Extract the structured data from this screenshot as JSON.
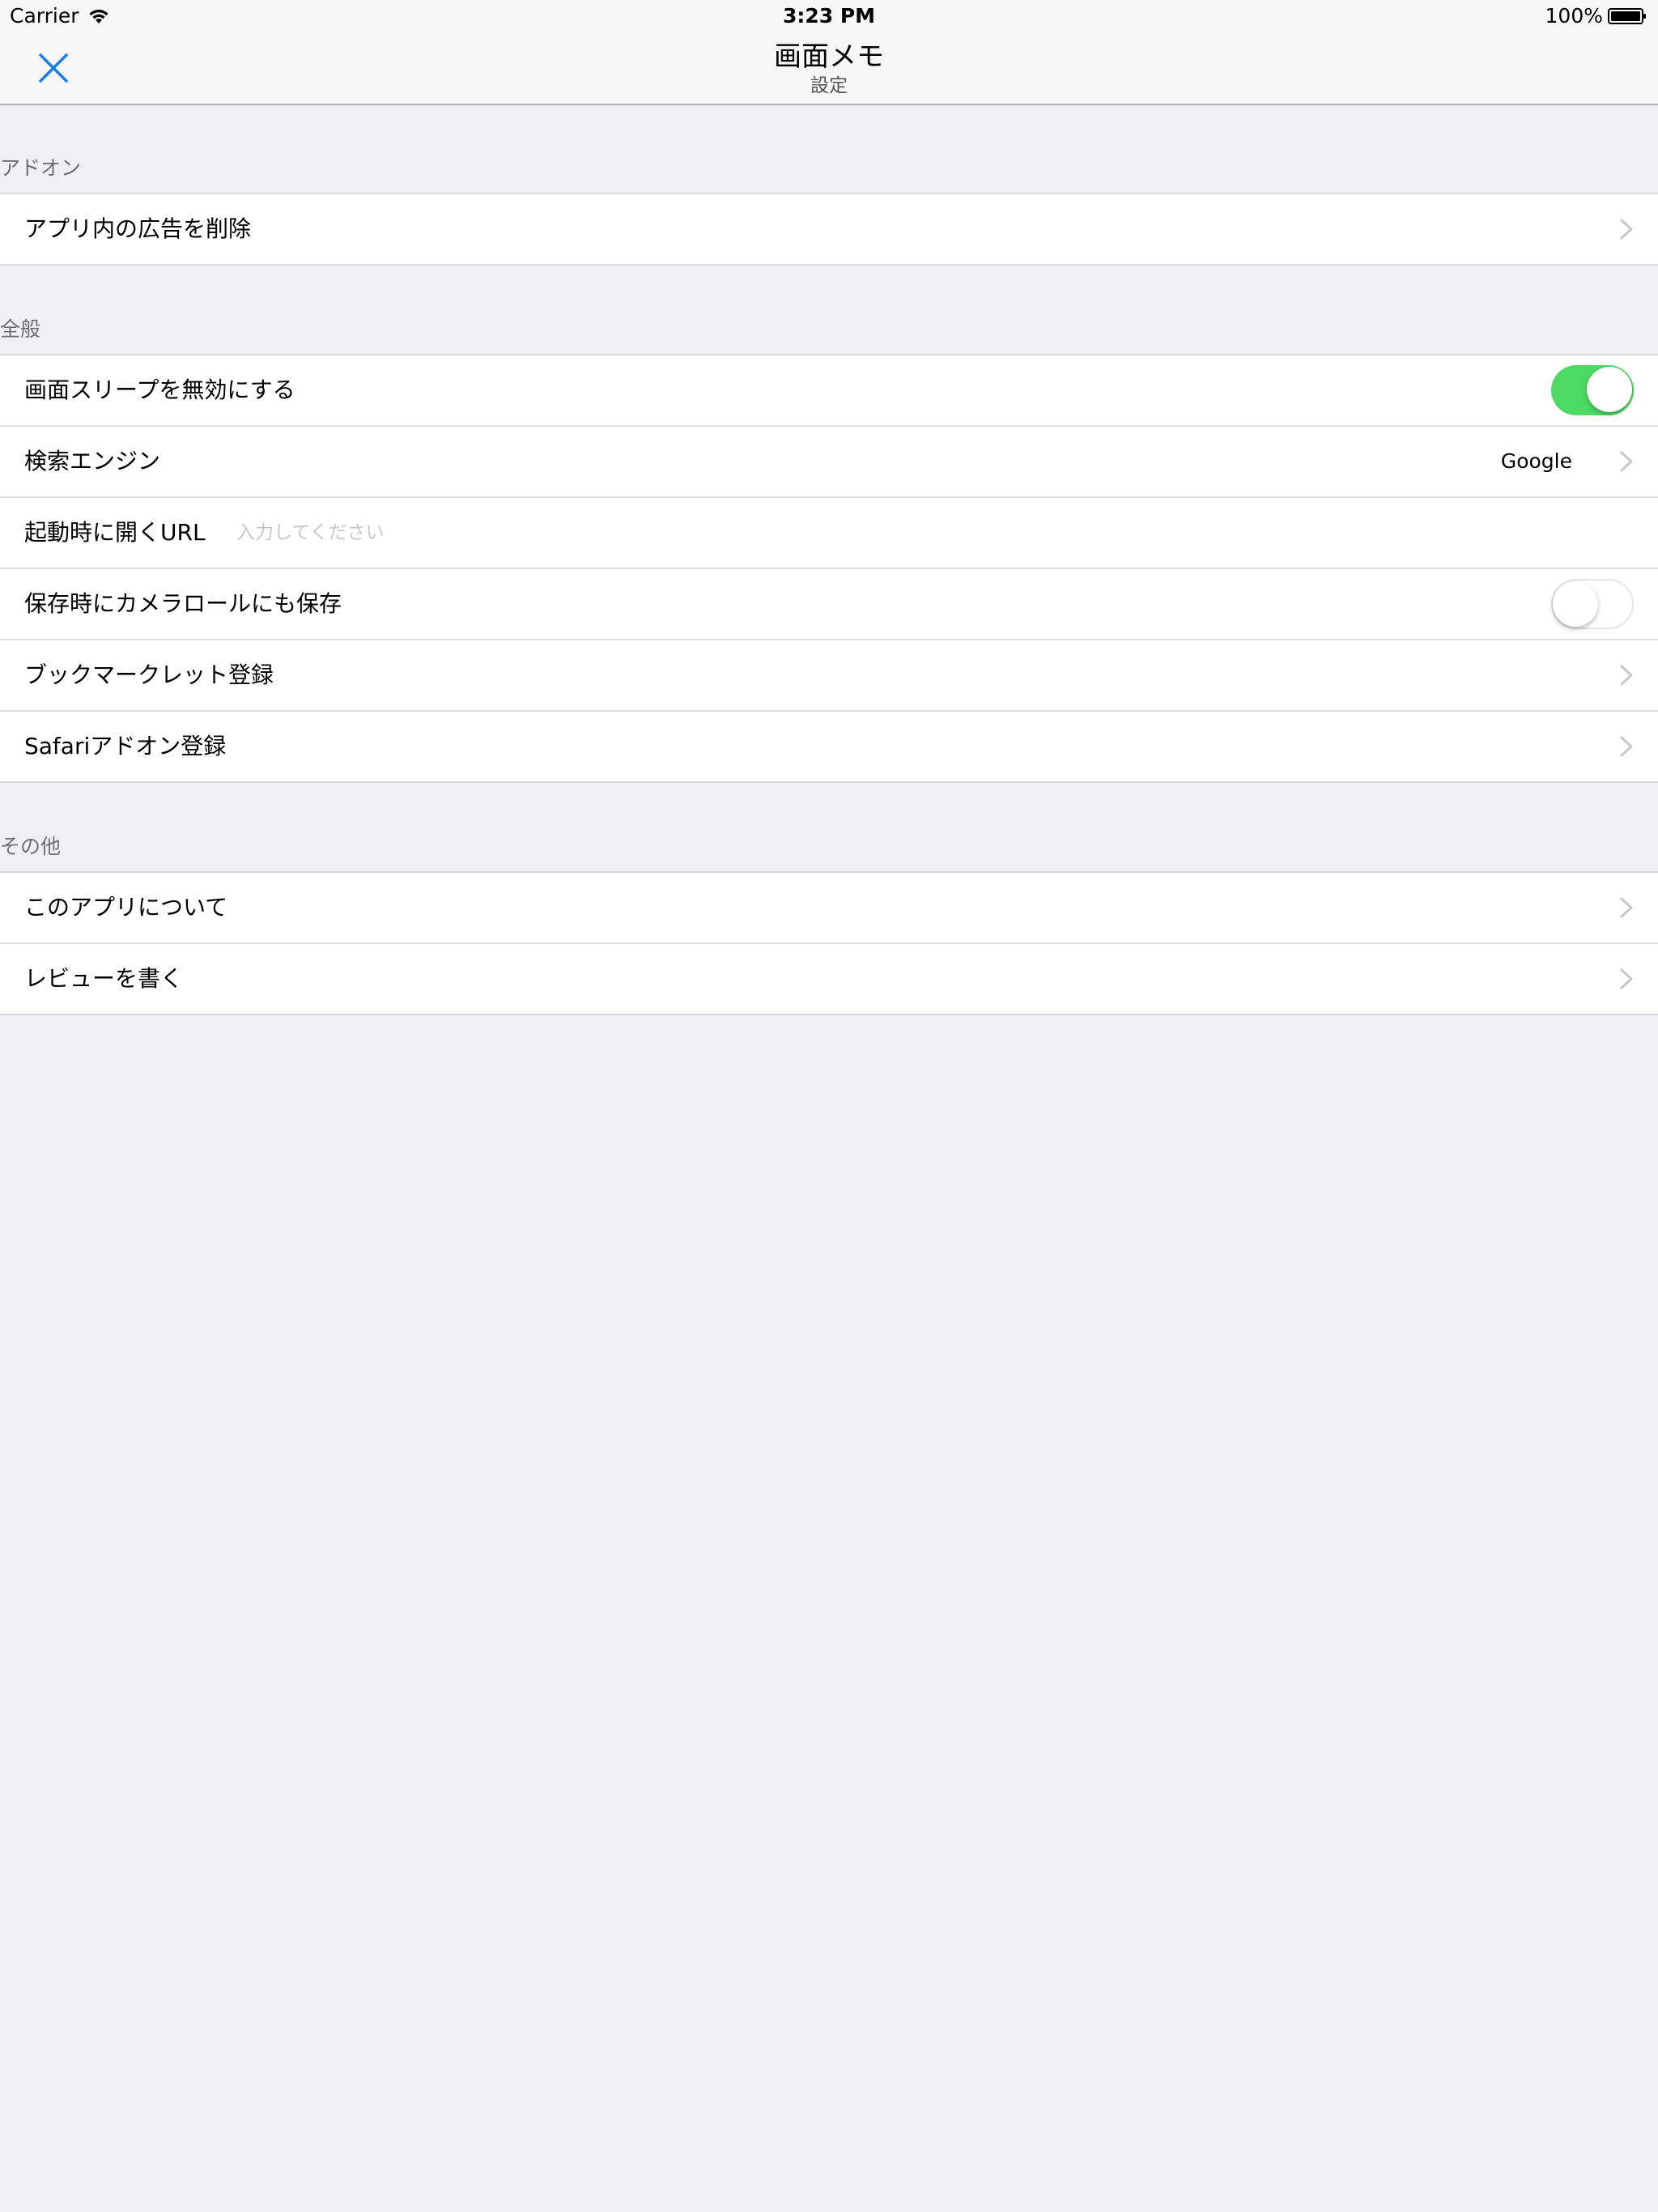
{
  "status_bar": {
    "carrier": "Carrier",
    "time": "3:23 PM",
    "battery": "100%"
  },
  "nav": {
    "title": "画面メモ",
    "subtitle": "設定",
    "accent_color": "#1a7ef2"
  },
  "sections": {
    "addon": {
      "header": "アドオン",
      "remove_ads": "アプリ内の広告を削除"
    },
    "general": {
      "header": "全般",
      "disable_sleep": "画面スリープを無効にする",
      "disable_sleep_on": true,
      "search_engine": "検索エンジン",
      "search_engine_value": "Google",
      "startup_url": "起動時に開くURL",
      "startup_url_placeholder": "入力してください",
      "startup_url_value": "",
      "save_camera_roll": "保存時にカメラロールにも保存",
      "save_camera_roll_on": false,
      "bookmarklet": "ブックマークレット登録",
      "safari_addon": "Safariアドオン登録"
    },
    "other": {
      "header": "その他",
      "about": "このアプリについて",
      "review": "レビューを書く"
    }
  },
  "colors": {
    "toggle_on": "#4cd964",
    "background": "#efeff4"
  }
}
